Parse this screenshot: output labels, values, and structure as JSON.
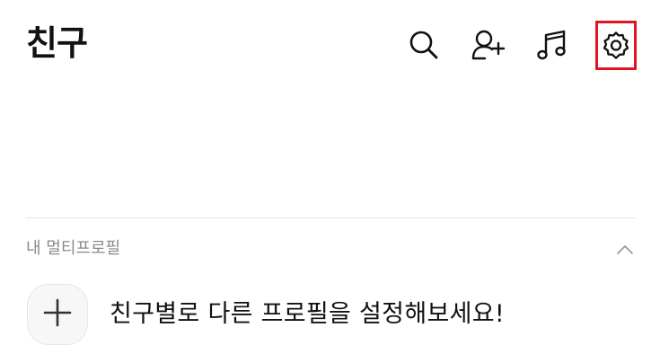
{
  "header": {
    "title": "친구",
    "icons": {
      "search": "search-icon",
      "add_friend": "add-friend-icon",
      "music": "music-note-icon",
      "settings": "gear-icon"
    },
    "highlight_color": "#e0141e"
  },
  "multi_profile": {
    "section_label": "내 멀티프로필",
    "collapse_icon": "chevron-up-icon",
    "add_icon": "plus-icon",
    "prompt": "친구별로 다른 프로필을 설정해보세요!"
  }
}
